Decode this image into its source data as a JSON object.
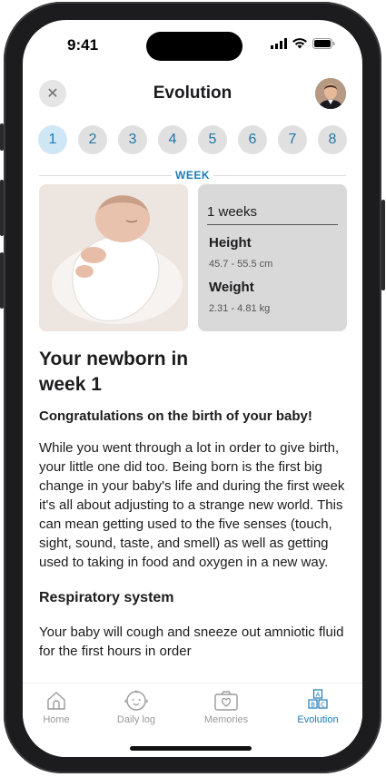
{
  "status": {
    "time": "9:41"
  },
  "header": {
    "title": "Evolution"
  },
  "weeks": [
    "1",
    "2",
    "3",
    "4",
    "5",
    "6",
    "7",
    "8"
  ],
  "week_label": "WEEK",
  "info": {
    "weeks": "1 weeks",
    "height_label": "Height",
    "height_value": "45.7 - 55.5 cm",
    "weight_label": "Weight",
    "weight_value": "2.31 - 4.81 kg"
  },
  "article": {
    "title_line1": "Your newborn in",
    "title_line2": "week 1",
    "subtitle": "Congratulations on the birth of your baby!",
    "body": "While you went through a lot in order to give birth, your little one did too. Being born is the first big change in your baby's life and during the first week it's all about adjusting to a strange new world. This can mean getting used to the five senses (touch, sight, sound, taste, and smell) as well as getting used to taking in food and oxygen in a new way.",
    "section_title": "Respiratory system",
    "section_body": "Your baby will cough and sneeze out amniotic fluid for the first hours in order"
  },
  "tabs": [
    {
      "label": "Home",
      "icon": "home-icon"
    },
    {
      "label": "Daily log",
      "icon": "baby-face-icon"
    },
    {
      "label": "Memories",
      "icon": "photo-heart-icon"
    },
    {
      "label": "Evolution",
      "icon": "abc-blocks-icon"
    }
  ],
  "colors": {
    "accent": "#1a7bb8",
    "selected_week_bg": "#cfe6f5",
    "card_bg": "#d9d9d9"
  }
}
